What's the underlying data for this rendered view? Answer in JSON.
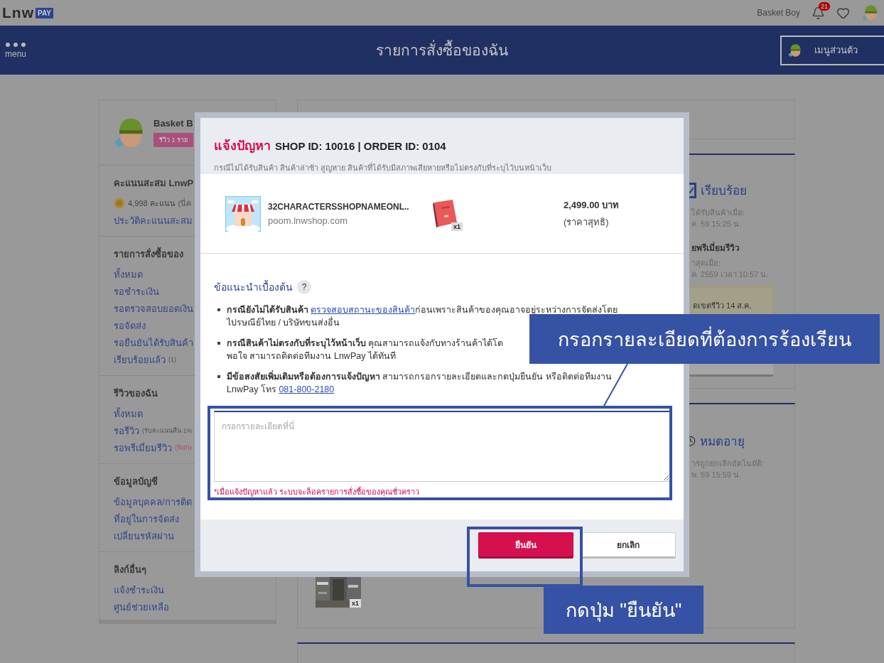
{
  "top_bar": {
    "logo": {
      "word": "Lnw",
      "tag": "PAY"
    },
    "user_name": "Basket Boy",
    "notification_count": "21"
  },
  "header": {
    "menu_label": "menu",
    "title": "รายการสั่งซื้อของฉัน",
    "personal_menu": "เมนูส่วนตัว"
  },
  "sidebar": {
    "profile": {
      "name": "Basket B",
      "badge": "รีวิว 1 ราย"
    },
    "sections": [
      {
        "title": "คะแนนสะสม LnwP",
        "points": {
          "value": "4,998 คะแนน",
          "note": "(นี่ค"
        },
        "links": [
          {
            "label": "ประวัติคะแนนสะสม"
          }
        ]
      },
      {
        "title": "รายการสั่งซื้อของ",
        "links": [
          {
            "label": "ทั้งหมด"
          },
          {
            "label": "รอชำระเงิน"
          },
          {
            "label": "รอตรวจสอบยอดเงิน"
          },
          {
            "label": "รอจัดส่ง"
          },
          {
            "label": "รอยืนยันได้รับสินค้า"
          },
          {
            "kind": "muted-note",
            "label": "เรียบร้อยแล้ว",
            "note": "(1)"
          }
        ]
      },
      {
        "title": "รีวิวของฉัน",
        "links": [
          {
            "label": "ทั้งหมด"
          },
          {
            "kind": "muted-note",
            "label": "รอรีวิว",
            "note": "(รับคะแนนคืน 1%"
          },
          {
            "kind": "accent-note",
            "label": "รอพรีเมี่ยมรีวิว",
            "note": "(พิเศษ"
          }
        ]
      },
      {
        "title": "ข้อมูลบัญชี",
        "links": [
          {
            "label": "ข้อมูลบุคคล/การติด"
          },
          {
            "label": "ที่อยู่ในการจัดส่ง"
          },
          {
            "label": "เปลี่ยนรหัสผ่าน"
          }
        ]
      },
      {
        "title": "ลิงก์อื่นๆ",
        "links": [
          {
            "label": "แจ้งชำระเงิน"
          },
          {
            "label": "ศูนย์ช่วยเหลือ"
          }
        ]
      }
    ]
  },
  "order_cards": [
    {
      "status": {
        "kind": "done",
        "label": "เรียบร้อย"
      },
      "items": [
        {
          "kind": "muted",
          "text": "ได้รับสินค้าเมื่อ:"
        },
        {
          "kind": "muted",
          "text": "ค. 59 15:25 น."
        },
        {
          "kind": "heading",
          "text": "ยพรีเมี่ยมรีวิว"
        },
        {
          "kind": "muted",
          "text": "าสุดเมื่อ:"
        },
        {
          "kind": "muted",
          "text": "ค. 2559 เวลา 10:57 น."
        },
        {
          "kind": "notice",
          "text": "ดเขตรีวิว 14 ส.ค."
        },
        {
          "kind": "button"
        }
      ]
    },
    {
      "status": {
        "kind": "expired",
        "label": "หมดอายุ"
      },
      "items": [
        {
          "kind": "muted",
          "text": "ารถูกยกเลิกอัตโนมัติ:"
        },
        {
          "kind": "muted",
          "text": "พ. 59 15:59 น."
        }
      ],
      "thumbnail": {
        "quantity": "x1"
      }
    }
  ],
  "dialog": {
    "title_label": "แจ้งปัญหา",
    "title_ids": "SHOP ID: 10016 | ORDER ID: 0104",
    "subtitle": "กรณีไม่ได้รับสินค้า สินค้าล่าช้า สูญหาย สินค้าที่ได้รับมีสภาพเสียหายหรือไม่ตรงกับที่ระบุไว้บนหน้าเว็บ",
    "shop": {
      "name": "32CHARACTERSSHOPNAMEONL..",
      "domain": "poom.lnwshop.com"
    },
    "product": {
      "quantity": "x1"
    },
    "price": "2,499.00 บาท",
    "price_note": "(ราคาสุทธิ)",
    "tips_title": "ข้อแนะนำเบื้องต้น",
    "help_mark": "?",
    "tips": [
      {
        "parts": [
          {
            "kind": "bold",
            "text": "กรณียังไม่ได้รับสินค้า "
          },
          {
            "kind": "link",
            "text": "ตรวจสอบสถานะของสินค้า"
          },
          {
            "kind": "plain",
            "text": "ก่อนเพราะสินค้าของคุณอาจอยู่ระหว่างการจัดส่งโดย\nไปรษณีย์ไทย / บริษัทขนส่งอื่น"
          }
        ]
      },
      {
        "parts": [
          {
            "kind": "bold",
            "text": "กรณีสินค้าไม่ตรงกับที่ระบุไว้หน้าเว็บ "
          },
          {
            "kind": "plain",
            "text": "คุณสามารถแจ้งกับทางร้านค้าได้โด\nพอใจ สามารถติดต่อทีมงาน LnwPay ได้ทันที"
          }
        ]
      },
      {
        "parts": [
          {
            "kind": "bold",
            "text": "มีข้อสงสัยเพิ่มเติมหรือต้องการแจ้งปัญหา "
          },
          {
            "kind": "plain",
            "text": "สามารถกรอกรายละเอียดและกดปุ่มยืนยัน หรือติดต่อทีมงาน\nLnwPay โทร "
          },
          {
            "kind": "link",
            "text": "081-800-2180"
          }
        ]
      }
    ],
    "textarea": {
      "placeholder": "กรอกรายละเอียดที่นี่"
    },
    "warning": "*เมื่อแจ้งปัญหาแล้ว ระบบจะล็อครายการสั่งซื้อของคุณชั่วคราว",
    "buttons": [
      {
        "kind": "primary",
        "label": "ยืนยัน"
      },
      {
        "kind": "secondary",
        "label": "ยกเลิก"
      }
    ]
  },
  "annotations": [
    {
      "text": "กรอกรายละเอียดที่ต้องการร้องเรียน"
    },
    {
      "text": "กดปุ่ม \"ยืนยัน\""
    }
  ]
}
